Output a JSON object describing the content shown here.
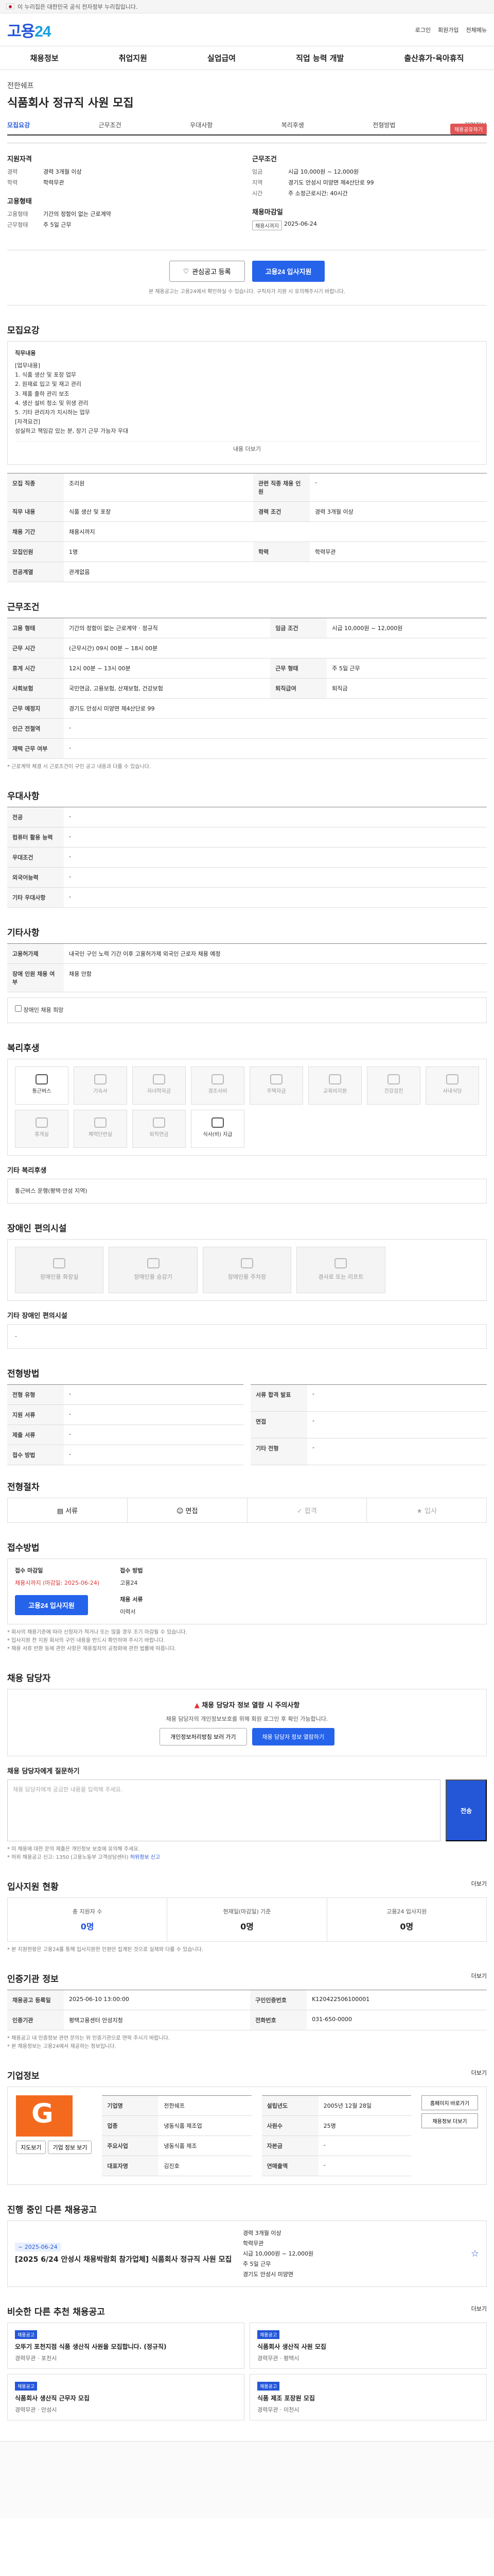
{
  "topbar": {
    "text": "이 누리집은 대한민국 공식 전자정부 누리집입니다."
  },
  "header": {
    "logo_main": "고용",
    "logo_sub": "24",
    "links": [
      "로그인",
      "회원가입",
      "전체메뉴"
    ]
  },
  "gnb": [
    "채용정보",
    "취업지원",
    "실업급여",
    "직업 능력 개발",
    "출산휴가·육아휴직"
  ],
  "job": {
    "company": "전한쉐프",
    "title": "식품회사 정규직 사원 모집",
    "share": "채용공유하기",
    "tabs": [
      "모집요강",
      "근무조건",
      "우대사항",
      "복리후생",
      "전형방법",
      "기업정보"
    ]
  },
  "summary": {
    "qualify_title": "지원자격",
    "qualify": [
      [
        "경력",
        "경력 3개월 이상"
      ],
      [
        "학력",
        "학력무관"
      ]
    ],
    "employ_title": "고용형태",
    "employ": [
      [
        "고용형태",
        "기간의 정함이 없는 근로계약"
      ],
      [
        "근무형태",
        "주 5일 근무"
      ]
    ],
    "cond_title": "근무조건",
    "cond": [
      [
        "임금",
        "시급 10,000원 ~ 12,000원"
      ],
      [
        "지역",
        "경기도 안성시 미양면 제4산단로 99"
      ],
      [
        "시간",
        "주 소정근로시간: 40시간"
      ]
    ],
    "recruit_title": "채용마감일",
    "recruit_chip": "채용시까지",
    "recruit_date": "2025-06-24"
  },
  "actions": {
    "scrap": "관심공고 등록",
    "apply": "고용24 입사지원",
    "note": "본 채용공고는 고용24에서 확인하실 수 있습니다. 구직자가 지원 시 유의해주시기 바랍니다."
  },
  "recruit": {
    "section": "모집요강",
    "desc_title": "직무내용",
    "desc_lines": [
      "[업무내용]",
      "1. 식품 생산 및 포장 업무",
      "2. 원재료 입고 및 재고 관리",
      "3. 제품 출하 관리 보조",
      "4. 생산 설비 청소 및 위생 관리",
      "5. 기타 관리자가 지시하는 업무",
      "[자격요건]",
      "성실하고 책임감 있는 분, 장기 근무 가능자 우대"
    ],
    "more": "내용 더보기",
    "rows": [
      [
        "모집 직종",
        "조리원",
        "관련 직종 채용 인원",
        "-"
      ],
      [
        "직무 내용",
        "식품 생산 및 포장",
        "경력 조건",
        "경력 3개월 이상"
      ],
      [
        "채용 기간",
        "채용시까지",
        "",
        ""
      ],
      [
        "모집인원",
        "1명",
        "학력",
        "학력무관"
      ],
      [
        "전공계열",
        "관계없음",
        "",
        ""
      ]
    ]
  },
  "work": {
    "section": "근무조건",
    "rows": [
      [
        "고용 형태",
        "기간의 정함이 없는 근로계약 · 정규직",
        "임금 조건",
        "시급 10,000원 ~ 12,000원"
      ],
      [
        "근무 시간",
        "(근무시간) 09시 00분 ~ 18시 00분",
        "",
        ""
      ],
      [
        "휴게 시간",
        "12시 00분 ~ 13시 00분",
        "근무 형태",
        "주 5일 근무"
      ],
      [
        "사회보험",
        "국민연금, 고용보험, 산재보험, 건강보험",
        "퇴직급여",
        "퇴직금"
      ],
      [
        "근무 예정지",
        "경기도 안성시 미양면 제4산단로 99",
        "",
        ""
      ],
      [
        "인근 전철역",
        "-",
        "",
        ""
      ],
      [
        "재택 근무 여부",
        "-",
        "",
        ""
      ]
    ],
    "note": "* 근로계약 체결 시 근로조건이 구인 공고 내용과 다를 수 있습니다."
  },
  "prefer": {
    "section": "우대사항",
    "rows": [
      [
        "전공",
        "-"
      ],
      [
        "컴퓨터 활용 능력",
        "-"
      ],
      [
        "우대조건",
        "-"
      ],
      [
        "외국어능력",
        "-"
      ],
      [
        "기타 우대사항",
        "-"
      ]
    ]
  },
  "etc": {
    "section": "기타사항",
    "rows": [
      [
        "고용허가제",
        "내국인 구인 노력 기간 이후 고용허가제 외국인 근로자 채용 예정"
      ],
      [
        "장애 인원 채용 여부",
        "채용 안함"
      ]
    ],
    "check": "장애인 채용 희망"
  },
  "welfare": {
    "section": "복리후생",
    "items": [
      {
        "label": "통근버스",
        "on": true
      },
      {
        "label": "기숙사",
        "on": false
      },
      {
        "label": "자녀학자금",
        "on": false
      },
      {
        "label": "경조사비",
        "on": false
      },
      {
        "label": "주택자금",
        "on": false
      },
      {
        "label": "교육비지원",
        "on": false
      },
      {
        "label": "건강검진",
        "on": false
      },
      {
        "label": "사내식당",
        "on": false
      },
      {
        "label": "휴게실",
        "on": false
      },
      {
        "label": "체력단련실",
        "on": false
      },
      {
        "label": "퇴직연금",
        "on": false
      },
      {
        "label": "식사(비) 지급",
        "on": true
      }
    ],
    "etc_title": "기타 복리후생",
    "etc_text": "통근버스 운행(평택·안성 지역)"
  },
  "disability": {
    "section": "장애인 편의시설",
    "items": [
      "장애인용 화장실",
      "장애인용 승강기",
      "장애인용 주차장",
      "경사로 또는 리프트"
    ],
    "etc_title": "기타 장애인 편의시설",
    "etc_text": "-"
  },
  "select": {
    "section": "전형방법",
    "rows": [
      [
        "전형 유형",
        "-"
      ],
      [
        "지원 서류",
        "-"
      ],
      [
        "제출 서류",
        "-"
      ],
      [
        "접수 방법",
        "-"
      ]
    ],
    "right_rows": [
      [
        "서류 합격 발표",
        "-"
      ],
      [
        "면접",
        "-"
      ],
      [
        "기타 전형",
        "-"
      ]
    ],
    "steps": [
      "서류",
      "면접",
      "합격",
      "입사"
    ]
  },
  "apply": {
    "section": "접수방법",
    "method_label": "접수 마감일",
    "method_value": "채용시까지 (마감일: 2025-06-24)",
    "method_btn": "고용24 입사지원",
    "contact_label": "접수 방법",
    "contact_value": "고용24",
    "count_label": "채용 서류",
    "count_value": "이력서",
    "notes": [
      "* 회사의 채용기준에 따라 신청자가 적거나 또는 많을 경우 조기 마감될 수 있습니다.",
      "* 입사지원 전 지원 회사의 구인 내용을 반드시 확인하여 주시기 바랍니다.",
      "* 채용 서류 반환 등에 관한 사항은 채용절차의 공정화에 관한 법률에 따릅니다."
    ]
  },
  "manager": {
    "section": "채용 담당자",
    "warn_title": "채용 담당자 정보 열람 시 주의사항",
    "warn_text": "채용 담당자의 개인정보보호를 위해 회원 로그인 후 확인 가능합니다.",
    "btn1": "개인정보처리방침 보러 가기",
    "btn2": "채용 담당자 정보 열람하기",
    "q_title": "채용 담당자에게 질문하기",
    "q_placeholder": "채용 담당자에게 궁금한 내용을 입력해 주세요.",
    "q_btn": "전송",
    "q_notes": [
      "* 이 채용에 대한 문의 제출은 개인정보 보호에 유의해 주세요.",
      "* 허위 채용공고 신고: 1350 (고용노동부 고객상담센터)"
    ],
    "q_link": "허위정보 신고"
  },
  "status": {
    "section": "입사지원 현황",
    "more": "더보기",
    "items": [
      [
        "총 지원자 수",
        "0명"
      ],
      [
        "현재일(마감일) 기준",
        "0명"
      ],
      [
        "고용24 입사지원",
        "0명"
      ]
    ],
    "note": "* 본 지원현황은 고용24를 통해 입사지원한 인원만 집계된 것으로 실제와 다를 수 있습니다."
  },
  "info": {
    "section": "인증기관 정보",
    "more": "더보기",
    "rows": [
      [
        "채용공고 등록일",
        "2025-06-10 13:00:00",
        "구인인증번호",
        "K120422506100001"
      ],
      [
        "인증기관",
        "평택고용센터 안성지청",
        "전화번호",
        "031-650-0000"
      ]
    ],
    "notes": [
      "* 채용공고 내 인증정보 관련 문의는 위 인증기관으로 연락 주시기 바랍니다.",
      "* 본 채용정보는 고용24에서 제공하는 정보입니다."
    ]
  },
  "company": {
    "section": "기업정보",
    "more": "더보기",
    "rows": [
      [
        "기업명",
        "전한쉐프"
      ],
      [
        "업종",
        "냉동식품 제조업"
      ],
      [
        "주요사업",
        "냉동식품 제조"
      ],
      [
        "대표자명",
        "김진호"
      ]
    ],
    "right_rows": [
      [
        "설립년도",
        "2005년 12월 28일"
      ],
      [
        "사원수",
        "25명"
      ],
      [
        "자본금",
        "-"
      ],
      [
        "연매출액",
        "-"
      ]
    ],
    "btn_home": "홈페이지 바로가기",
    "btn_more": "채용정보 더보기",
    "btn_map": "지도보기",
    "btn_visit": "기업 정보 보기"
  },
  "other": {
    "section": "진행 중인 다른 채용공고",
    "date": "~ 2025-06-24",
    "title": "[2025 6/24 안성시 채용박람회 참가업체] 식품회사 정규직 사원 모집",
    "detail": [
      "경력 3개월 이상",
      "학력무관",
      "시급 10,000원 ~ 12,000원",
      "주 5일 근무",
      "경기도 안성시 미양면"
    ]
  },
  "recommend": {
    "section": "비슷한 다른 추천 채용공고",
    "more": "더보기",
    "cards": [
      {
        "tag": "채용공고",
        "title": "오뚜기 포천지점 식품 생산직 사원을 모집합니다. (정규직)",
        "meta": "경력무관 · 포천시"
      },
      {
        "tag": "채용공고",
        "title": "식품회사 생산직 사원 모집",
        "meta": "경력무관 · 평택시"
      },
      {
        "tag": "채용공고",
        "title": "식품회사 생산직 근무자 모집",
        "meta": "경력무관 · 안성시"
      },
      {
        "tag": "채용공고",
        "title": "식품 제조 포장원 모집",
        "meta": "경력무관 · 이천시"
      }
    ]
  }
}
